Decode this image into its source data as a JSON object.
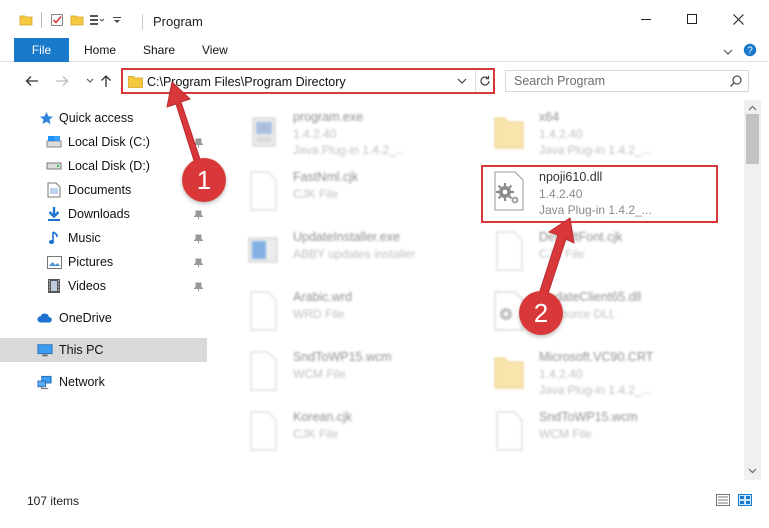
{
  "window": {
    "title": "Program",
    "minimize_glyph": "—",
    "maximize_glyph": "☐",
    "close_glyph": "✕"
  },
  "ribbon": {
    "file": "File",
    "home": "Home",
    "share": "Share",
    "view": "View"
  },
  "address": {
    "path": "C:\\Program Files\\Program Directory",
    "search_placeholder": "Search Program"
  },
  "nav": {
    "quick_access": "Quick access",
    "local_c": "Local Disk (C:)",
    "local_d": "Local Disk (D:)",
    "documents": "Documents",
    "downloads": "Downloads",
    "music": "Music",
    "pictures": "Pictures",
    "videos": "Videos",
    "onedrive": "OneDrive",
    "this_pc": "This PC",
    "network": "Network"
  },
  "files": [
    {
      "name": "program.exe",
      "line1": "1.4.2.40",
      "line2": "Java Plug-in 1.4.2_..."
    },
    {
      "name": "x64",
      "line1": "1.4.2.40",
      "line2": "Java Plug-in 1.4.2_..."
    },
    {
      "name": "FastNml.cjk",
      "line1": "CJK File",
      "line2": ""
    },
    {
      "name": "npoji610.dll",
      "line1": "1.4.2.40",
      "line2": "Java Plug-in 1.4.2_..."
    },
    {
      "name": "UpdateInstaller.exe",
      "line1": "ABBY updates installer",
      "line2": ""
    },
    {
      "name": "DefaultFont.cjk",
      "line1": "CJK File",
      "line2": ""
    },
    {
      "name": "Arabic.wrd",
      "line1": "WRD File",
      "line2": ""
    },
    {
      "name": "UpdateClient65.dll",
      "line1": "Resource DLL",
      "line2": ""
    },
    {
      "name": "SndToWP15.wcm",
      "line1": "WCM File",
      "line2": ""
    },
    {
      "name": "Microsoft.VC90.CRT",
      "line1": "1.4.2.40",
      "line2": "Java Plug-in 1.4.2_..."
    },
    {
      "name": "Korean.cjk",
      "line1": "CJK File",
      "line2": ""
    },
    {
      "name": "SndToWP15.wcm",
      "line1": "WCM File",
      "line2": ""
    }
  ],
  "status": {
    "item_count": "107 items"
  },
  "annotations": {
    "step1": "1",
    "step2": "2",
    "color": "#d9383a"
  },
  "colors": {
    "accent": "#1979ca",
    "selection": "#cce8ff",
    "highlight": "#d9383a"
  }
}
